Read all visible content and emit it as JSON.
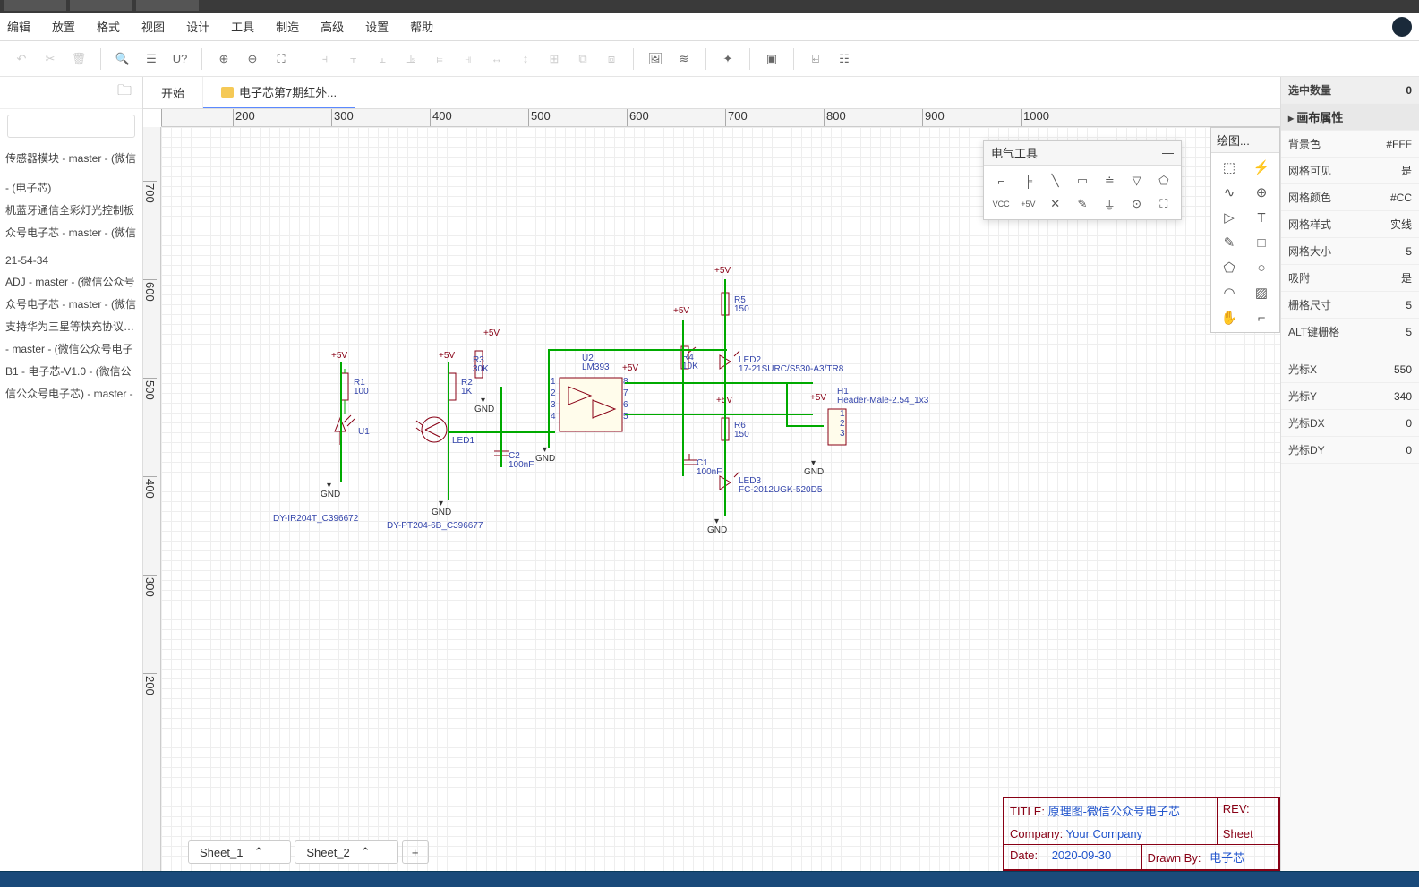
{
  "menu": {
    "items": [
      "编辑",
      "放置",
      "格式",
      "视图",
      "设计",
      "工具",
      "制造",
      "高级",
      "设置",
      "帮助"
    ]
  },
  "tabs": {
    "start": "开始",
    "file": "电子芯第7期红外..."
  },
  "left_tree": [
    "传感器模块 - master - (微信",
    "",
    "- (电子芯)",
    "机蓝牙通信全彩灯光控制板",
    "众号电子芯 - master - (微信",
    "",
    "21-54-34",
    "ADJ - master - (微信公众号",
    "众号电子芯 - master - (微信",
    "支持华为三星等快充协议-为手",
    "- master - (微信公众号电子",
    "B1 - 电子芯-V1.0 - (微信公",
    "信公众号电子芯) - master -"
  ],
  "ruler_h": [
    "200",
    "300",
    "400",
    "500",
    "600",
    "700",
    "800",
    "900",
    "1000"
  ],
  "ruler_v": [
    "700",
    "600",
    "500",
    "400",
    "300",
    "200"
  ],
  "etool": {
    "title": "电气工具"
  },
  "rtool": {
    "title": "绘图..."
  },
  "selection": {
    "label": "选中数量",
    "value": "0"
  },
  "canvas_props": {
    "title": "画布属性",
    "rows": [
      {
        "l": "背景色",
        "v": "#FFF"
      },
      {
        "l": "网格可见",
        "v": "是"
      },
      {
        "l": "网格颜色",
        "v": "#CC"
      },
      {
        "l": "网格样式",
        "v": "实线"
      },
      {
        "l": "网格大小",
        "v": "5"
      },
      {
        "l": "吸附",
        "v": "是"
      },
      {
        "l": "栅格尺寸",
        "v": "5"
      },
      {
        "l": "ALT键栅格",
        "v": "5"
      }
    ]
  },
  "cursor": {
    "rows": [
      {
        "l": "光标X",
        "v": "550"
      },
      {
        "l": "光标Y",
        "v": "340"
      },
      {
        "l": "光标DX",
        "v": "0"
      },
      {
        "l": "光标DY",
        "v": "0"
      }
    ]
  },
  "sheets": {
    "s1": "Sheet_1",
    "s2": "Sheet_2"
  },
  "title_block": {
    "title_l": "TITLE:",
    "title_v": "原理图-微信公众号电子芯",
    "rev_l": "REV:",
    "comp_l": "Company:",
    "comp_v": "Your Company",
    "sheet_l": "Sheet",
    "date_l": "Date:",
    "date_v": "2020-09-30",
    "drawn_l": "Drawn By:",
    "drawn_v": "电子芯"
  },
  "schematic": {
    "parts": {
      "U1": "U1",
      "U2": "U2",
      "U2_val": "LM393",
      "R1": "R1",
      "R1_val": "100",
      "R2": "R2",
      "R2_val": "1K",
      "R3": "R3",
      "R3_val": "30K",
      "R4": "R4",
      "R4_val": "10K",
      "R5": "R5",
      "R5_val": "150",
      "R6": "R6",
      "R6_val": "150",
      "C1": "C1",
      "C1_val": "100nF",
      "C2": "C2",
      "C2_val": "100nF",
      "LED1": "LED1",
      "LED2": "LED2",
      "LED2_val": "17-21SURC/S530-A3/TR8",
      "LED3": "LED3",
      "LED3_val": "FC-2012UGK-520D5",
      "H1": "H1",
      "H1_val": "Header-Male-2.54_1x3",
      "D1": "DY-IR204T_C396672",
      "D2": "DY-PT204-6B_C396677",
      "p5v": "+5V",
      "gnd": "GND",
      "pins": "1\n2\n3",
      "upins": "8\n7\n6\n5",
      "upinsl": "1\n2\n3\n4"
    }
  }
}
